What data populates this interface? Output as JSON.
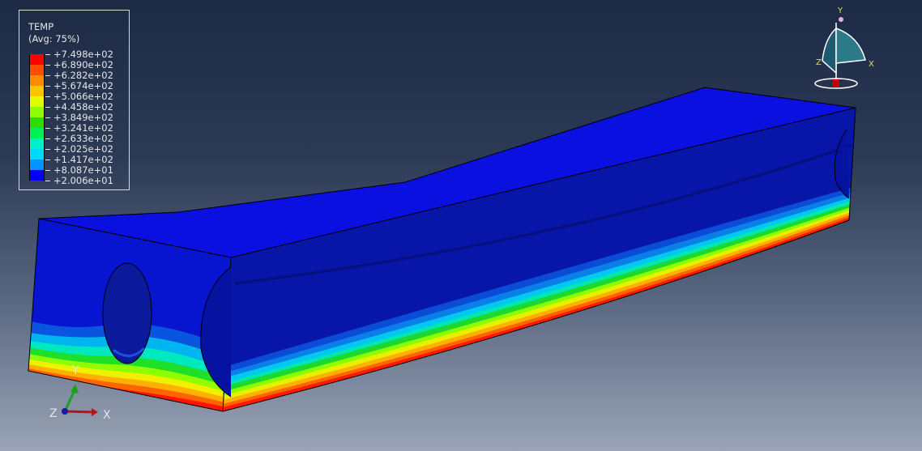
{
  "legend": {
    "title": "TEMP",
    "subtitle": "(Avg: 75%)",
    "entries": [
      {
        "label": "+7.498e+02",
        "color": "#ff0000"
      },
      {
        "label": "+6.890e+02",
        "color": "#ff4d00"
      },
      {
        "label": "+6.282e+02",
        "color": "#ff8c00"
      },
      {
        "label": "+5.674e+02",
        "color": "#ffc400"
      },
      {
        "label": "+5.066e+02",
        "color": "#e0ff00"
      },
      {
        "label": "+4.458e+02",
        "color": "#8cff00"
      },
      {
        "label": "+3.849e+02",
        "color": "#2ddd00"
      },
      {
        "label": "+3.241e+02",
        "color": "#00ef55"
      },
      {
        "label": "+2.633e+02",
        "color": "#00f0c8"
      },
      {
        "label": "+2.025e+02",
        "color": "#00d8ff"
      },
      {
        "label": "+1.417e+02",
        "color": "#0094ff"
      },
      {
        "label": "+8.087e+01",
        "color": "#0049ff"
      },
      {
        "label": "+2.006e+01",
        "color": "#0000f0"
      }
    ]
  },
  "triad": {
    "x_label": "X",
    "y_label": "Y",
    "z_label": "Z"
  },
  "view_cube": {
    "x_label": "X",
    "y_label": "Y",
    "z_label": "Z"
  }
}
